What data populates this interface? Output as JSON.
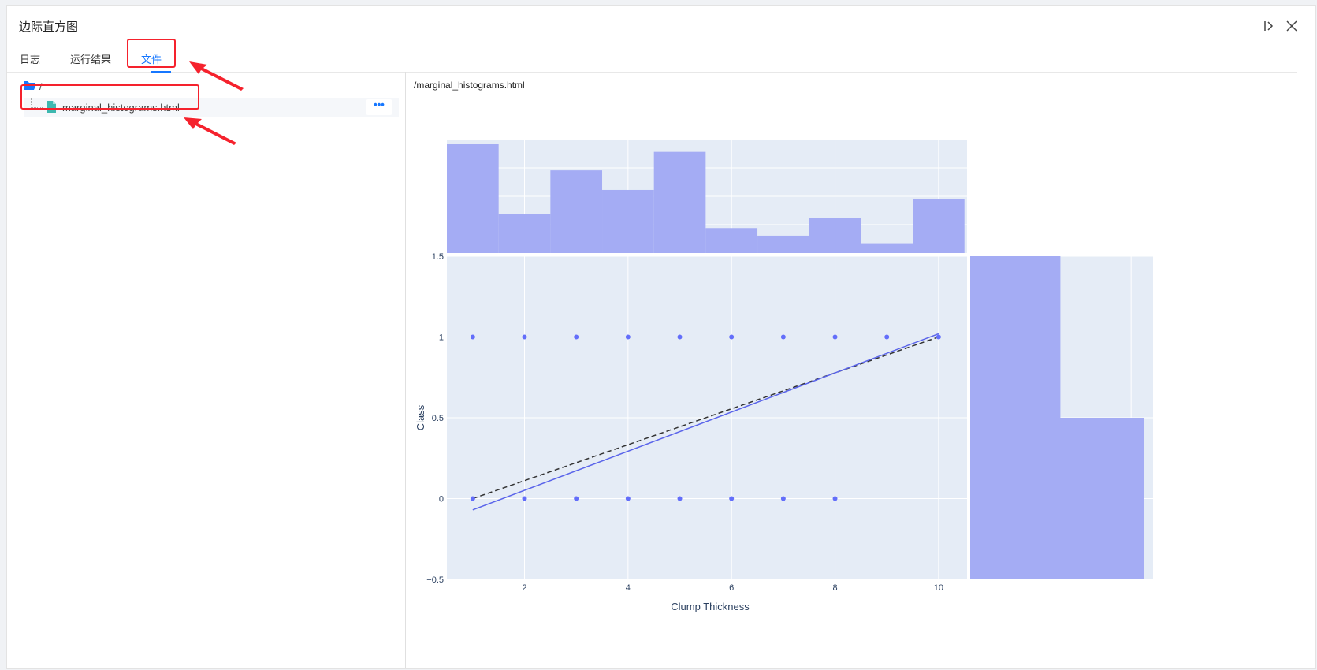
{
  "window": {
    "title": "边际直方图"
  },
  "header_icons": {
    "collapse": "collapse-right-icon",
    "close": "close-icon"
  },
  "tabs": [
    {
      "label": "日志"
    },
    {
      "label": "运行结果"
    },
    {
      "label": "文件",
      "active": true
    }
  ],
  "file_tree": {
    "root": "/",
    "files": [
      {
        "name": "marginal_histograms.html"
      }
    ],
    "more_label": "•••"
  },
  "preview": {
    "path": "/marginal_histograms.html"
  },
  "colors": {
    "accent": "#1677ff",
    "highlight": "#f5222d",
    "plot_bg": "#e5ecf6",
    "bar": "#a4acf4",
    "marker": "#636efa",
    "trend": "#5a64ea"
  },
  "chart_data": {
    "type": "scatter",
    "xlabel": "Clump Thickness",
    "ylabel": "Class",
    "xlim": [
      0.5,
      10.55
    ],
    "ylim": [
      -0.5,
      1.5
    ],
    "xticks": [
      2,
      4,
      6,
      8,
      10
    ],
    "yticks": [
      -0.5,
      0,
      0.5,
      1,
      1.5
    ],
    "xtick_labels": [
      "2",
      "4",
      "6",
      "8",
      "10"
    ],
    "ytick_labels": [
      "−0.5",
      "0",
      "0.5",
      "1",
      "1.5"
    ],
    "points_class1_x": [
      1,
      2,
      3,
      4,
      5,
      6,
      7,
      8,
      9,
      10
    ],
    "points_class0_x": [
      1,
      2,
      3,
      4,
      5,
      6,
      7,
      8
    ],
    "trend_solid": [
      [
        1,
        -0.07
      ],
      [
        10,
        1.02
      ]
    ],
    "trend_dashed": [
      [
        1,
        0
      ],
      [
        10,
        1
      ]
    ],
    "top_histogram": {
      "bins": [
        [
          0.5,
          1.5
        ],
        [
          1.5,
          2.5
        ],
        [
          2.5,
          3.5
        ],
        [
          3.5,
          4.5
        ],
        [
          4.5,
          5.5
        ],
        [
          5.5,
          6.5
        ],
        [
          6.5,
          7.5
        ],
        [
          7.5,
          8.5
        ],
        [
          8.5,
          9.5
        ],
        [
          9.5,
          10.5
        ]
      ],
      "counts": [
        100,
        36,
        76,
        58,
        93,
        23,
        16,
        32,
        9,
        50
      ]
    },
    "right_histogram": {
      "bins": [
        [
          -0.5,
          0.5
        ],
        [
          0.5,
          1.5
        ]
      ],
      "counts": [
        100,
        52
      ]
    },
    "grid": true,
    "legend": "none"
  }
}
